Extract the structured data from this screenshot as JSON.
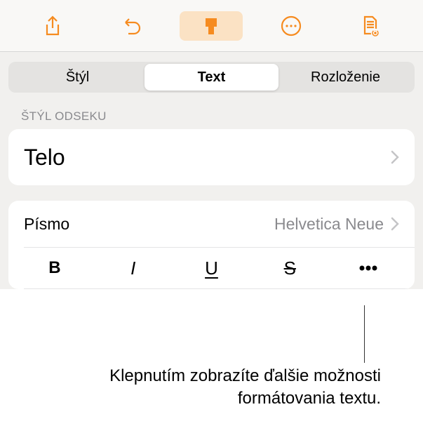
{
  "toolbar": {
    "share": "share",
    "undo": "undo",
    "format": "format-brush",
    "more": "more",
    "document": "document"
  },
  "tabs": {
    "style": "Štýl",
    "text": "Text",
    "layout": "Rozloženie"
  },
  "paragraph": {
    "header": "ŠTÝL ODSEKU",
    "style_name": "Telo"
  },
  "font": {
    "label": "Písmo",
    "value": "Helvetica Neue"
  },
  "format_buttons": {
    "bold": "B",
    "italic": "I",
    "underline": "U",
    "strike": "S"
  },
  "callout": "Klepnutím zobrazíte ďalšie možnosti formátovania textu."
}
